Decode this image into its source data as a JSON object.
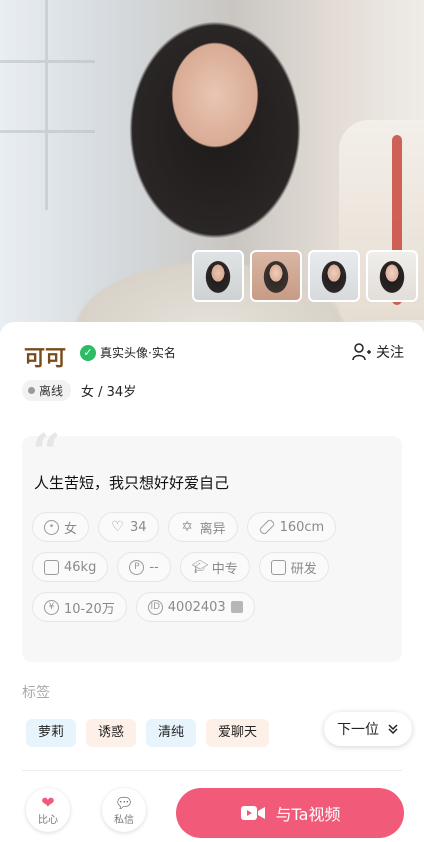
{
  "profile": {
    "name": "可可",
    "verified_label": "真实头像·实名",
    "follow_label": "关注",
    "status": "离线",
    "gender_age": "女 / 34岁"
  },
  "bio": {
    "text": "人生苦短，我只想好好爱自己",
    "chips": [
      {
        "icon": "person-icon",
        "label": "女"
      },
      {
        "icon": "heart-icon",
        "label": "34"
      },
      {
        "icon": "star-of-david-icon",
        "label": "离异"
      },
      {
        "icon": "ruler-icon",
        "label": "160cm"
      },
      {
        "icon": "scale-icon",
        "label": "46kg"
      },
      {
        "icon": "p-circle-icon",
        "label": "--"
      },
      {
        "icon": "grad-cap-icon",
        "label": "中专"
      },
      {
        "icon": "briefcase-icon",
        "label": "研发"
      },
      {
        "icon": "yen-icon",
        "label": "10-20万"
      },
      {
        "icon": "id-icon",
        "label": "4002403"
      }
    ]
  },
  "tags": {
    "title": "标签",
    "items": [
      {
        "label": "萝莉",
        "color": "#e8f4fb"
      },
      {
        "label": "诱惑",
        "color": "#fdf0e8"
      },
      {
        "label": "清纯",
        "color": "#e8f4fb"
      },
      {
        "label": "爱聊天",
        "color": "#fdf0e8"
      }
    ]
  },
  "next": {
    "label": "下一位"
  },
  "actions": {
    "like_label": "比心",
    "message_label": "私信",
    "video_label": "与Ta视频"
  },
  "colors": {
    "accent": "#f25a7a",
    "name": "#7a4a18",
    "verified": "#2dbb63"
  }
}
